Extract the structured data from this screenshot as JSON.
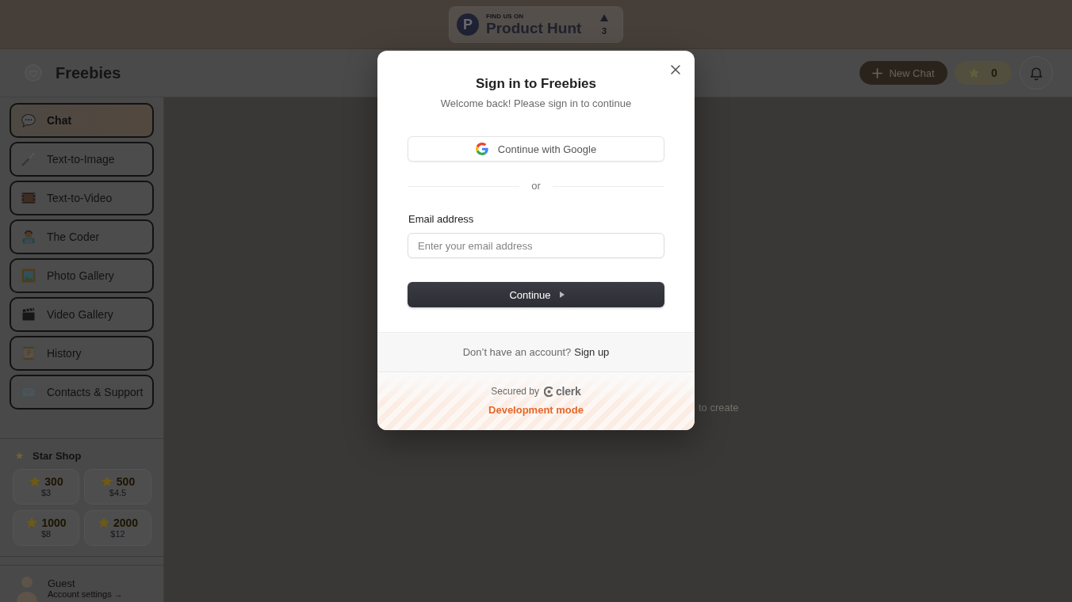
{
  "promo_badge": {
    "logo_letter": "P",
    "eyebrow": "FIND US ON",
    "title": "Product Hunt",
    "votes": "3"
  },
  "header": {
    "app_name": "Freebies",
    "new_chat": "New Chat",
    "star_balance": "0"
  },
  "sidebar": {
    "items": [
      {
        "label": "Chat",
        "selected": true
      },
      {
        "label": "Text-to-Image",
        "selected": false
      },
      {
        "label": "Text-to-Video",
        "selected": false
      },
      {
        "label": "The Coder",
        "selected": false
      },
      {
        "label": "Photo Gallery",
        "selected": false
      },
      {
        "label": "Video Gallery",
        "selected": false
      },
      {
        "label": "History",
        "selected": false
      },
      {
        "label": "Contacts & Support",
        "selected": false
      }
    ],
    "star_shop": {
      "title": "Star Shop",
      "packages": [
        {
          "amount": "300",
          "price": "$3"
        },
        {
          "amount": "500",
          "price": "$4.5"
        },
        {
          "amount": "1000",
          "price": "$8"
        },
        {
          "amount": "2000",
          "price": "$12"
        }
      ]
    },
    "user": {
      "name": "Guest",
      "link": "Account settings →"
    }
  },
  "main": {
    "hint": "to create"
  },
  "sign_in_dialog": {
    "title": "Sign in to Freebies",
    "subtitle": "Welcome back! Please sign in to continue",
    "google_button": "Continue with Google",
    "divider": "or",
    "email": {
      "label": "Email address",
      "placeholder": "Enter your email address"
    },
    "submit": "Continue",
    "signup_prompt": "Don’t have an account?",
    "signup_link": "Sign up",
    "secured_by": "Secured by",
    "brand": "clerk",
    "mode_notice": "Development mode"
  }
}
